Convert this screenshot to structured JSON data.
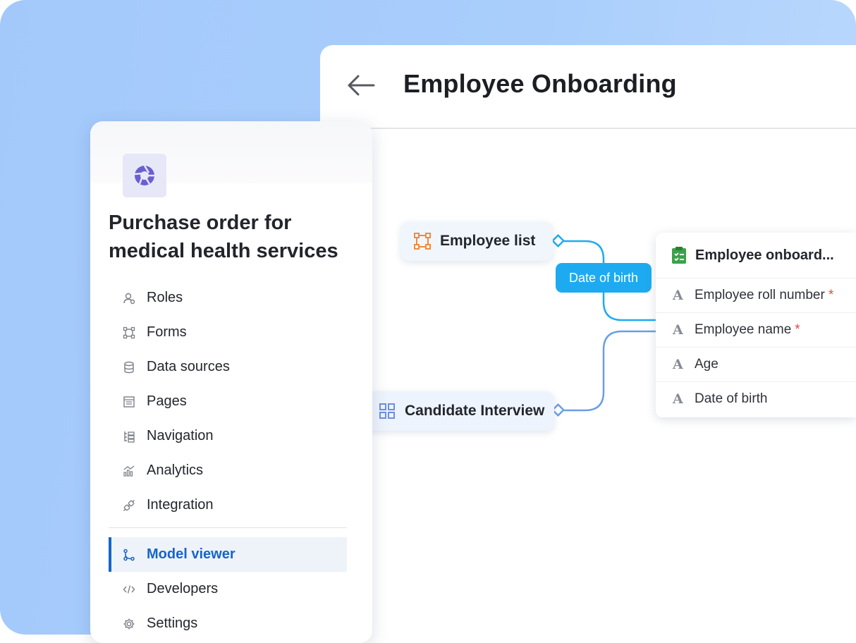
{
  "main": {
    "title": "Employee Onboarding"
  },
  "model": {
    "node_employee_list": "Employee list",
    "node_candidate_interview": "Candidate Interview",
    "edge_label": "Date of birth",
    "entity": {
      "title": "Employee onboard...",
      "fields": [
        {
          "icon": "A",
          "label": "Employee roll number",
          "required": "*"
        },
        {
          "icon": "A",
          "label": "Employee name",
          "required": "*"
        },
        {
          "icon": "A",
          "label": "Age",
          "required": ""
        },
        {
          "icon": "A",
          "label": "Date of birth",
          "required": ""
        }
      ]
    }
  },
  "sidebar": {
    "app_title": "Purchase order for medical health services",
    "items": [
      {
        "label": "Roles",
        "icon": "roles-icon"
      },
      {
        "label": "Forms",
        "icon": "forms-icon"
      },
      {
        "label": "Data sources",
        "icon": "database-icon"
      },
      {
        "label": "Pages",
        "icon": "pages-icon"
      },
      {
        "label": "Navigation",
        "icon": "navigation-icon"
      },
      {
        "label": "Analytics",
        "icon": "analytics-icon"
      },
      {
        "label": "Integration",
        "icon": "integration-icon"
      }
    ],
    "items_bottom": [
      {
        "label": "Model viewer",
        "icon": "model-viewer-icon",
        "active": true
      },
      {
        "label": "Developers",
        "icon": "code-icon"
      },
      {
        "label": "Settings",
        "icon": "gear-icon"
      }
    ]
  },
  "colors": {
    "accent": "#1565c9",
    "edge": "#1eaaf0",
    "background": "#a9cefc"
  }
}
